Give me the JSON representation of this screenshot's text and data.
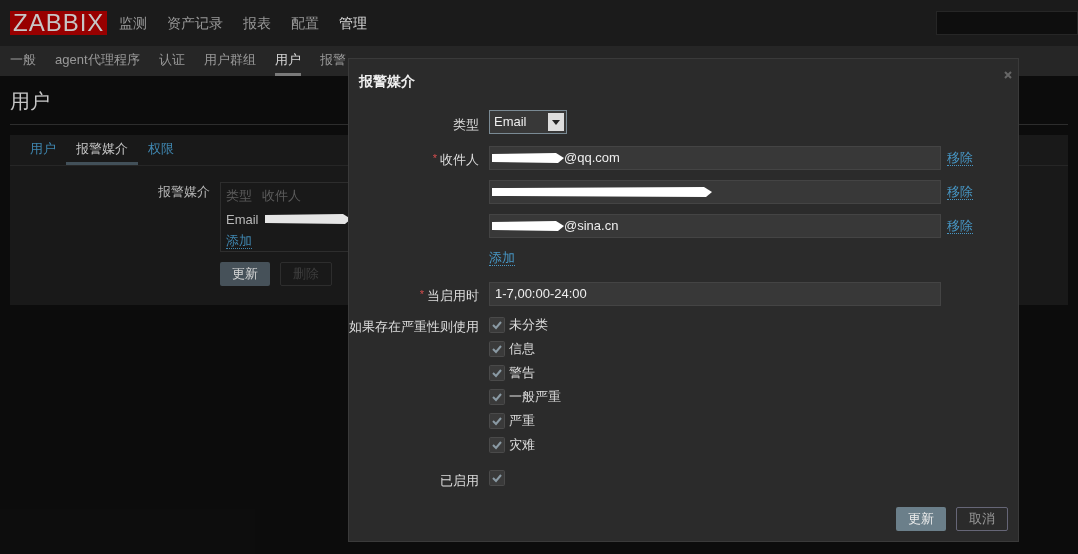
{
  "nav": {
    "logo": "ZABBIX",
    "menu": [
      {
        "label": "监测",
        "selected": false
      },
      {
        "label": "资产记录",
        "selected": false
      },
      {
        "label": "报表",
        "selected": false
      },
      {
        "label": "配置",
        "selected": false
      },
      {
        "label": "管理",
        "selected": true
      }
    ]
  },
  "subnav": [
    {
      "label": "一般",
      "selected": false
    },
    {
      "label": "agent代理程序",
      "selected": false
    },
    {
      "label": "认证",
      "selected": false
    },
    {
      "label": "用户群组",
      "selected": false
    },
    {
      "label": "用户",
      "selected": true
    },
    {
      "label": "报警",
      "selected": false
    }
  ],
  "page_title": "用户",
  "card": {
    "tabs": [
      {
        "label": "用户",
        "selected": false
      },
      {
        "label": "报警媒介",
        "selected": true
      },
      {
        "label": "权限",
        "selected": false
      }
    ],
    "media_label": "报警媒介",
    "media_columns": [
      "类型",
      "收件人"
    ],
    "media_rows": [
      {
        "type": "Email",
        "redacted": true
      }
    ],
    "add_link": "添加",
    "buttons": [
      {
        "label": "更新",
        "disabled": false
      },
      {
        "label": "删除",
        "disabled": true
      }
    ]
  },
  "dialog": {
    "title": "报警媒介",
    "type_label": "类型",
    "type_value": "Email",
    "recipient_label": "收件人",
    "recipient_mark": "*",
    "recipients": [
      {
        "value": "@qq.com",
        "redacted": true,
        "remove": "移除"
      },
      {
        "redacted": true,
        "remove": "移除"
      },
      {
        "value": "@sina.cn",
        "redacted": true,
        "remove": "移除"
      }
    ],
    "add_link": "添加",
    "period_label": "当启用时",
    "period_mark": "*",
    "period_value": "1-7,00:00-24:00",
    "severity_label": "如果存在严重性则使用",
    "severities": [
      {
        "label": "未分类",
        "checked": true
      },
      {
        "label": "信息",
        "checked": true
      },
      {
        "label": "警告",
        "checked": true
      },
      {
        "label": "一般严重",
        "checked": true
      },
      {
        "label": "严重",
        "checked": true
      },
      {
        "label": "灾难",
        "checked": true
      }
    ],
    "enabled": {
      "label": "已启用",
      "checked": true
    },
    "buttons": [
      {
        "label": "更新",
        "kind": "primary"
      },
      {
        "label": "取消",
        "kind": "secondary"
      }
    ]
  }
}
